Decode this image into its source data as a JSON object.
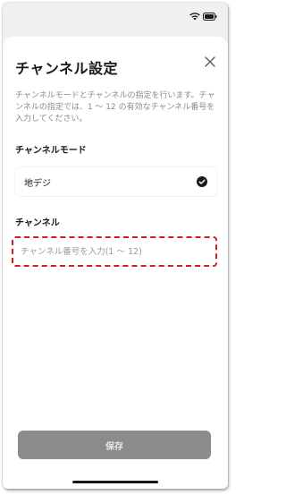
{
  "dialog": {
    "title": "チャンネル設定",
    "description": "チャンネルモードとチャンネルの指定を行います。チャンネルの指定では、1 〜 12 の有効なチャンネル番号を入力してください。"
  },
  "mode_section": {
    "label": "チャンネルモード",
    "selected_value": "地デジ"
  },
  "channel_section": {
    "label": "チャンネル",
    "input_value": "",
    "input_placeholder": "チャンネル番号を入力(1 〜 12)"
  },
  "actions": {
    "save_label": "保存"
  },
  "icons": {
    "close": "close-icon",
    "check": "check-circle-icon",
    "wifi": "wifi-icon",
    "battery": "battery-icon"
  },
  "colors": {
    "highlight": "#cc1f1f",
    "save_button": "#8c8c8c",
    "sheet_background": "#ffffff",
    "backdrop": "#f0f0f0"
  }
}
